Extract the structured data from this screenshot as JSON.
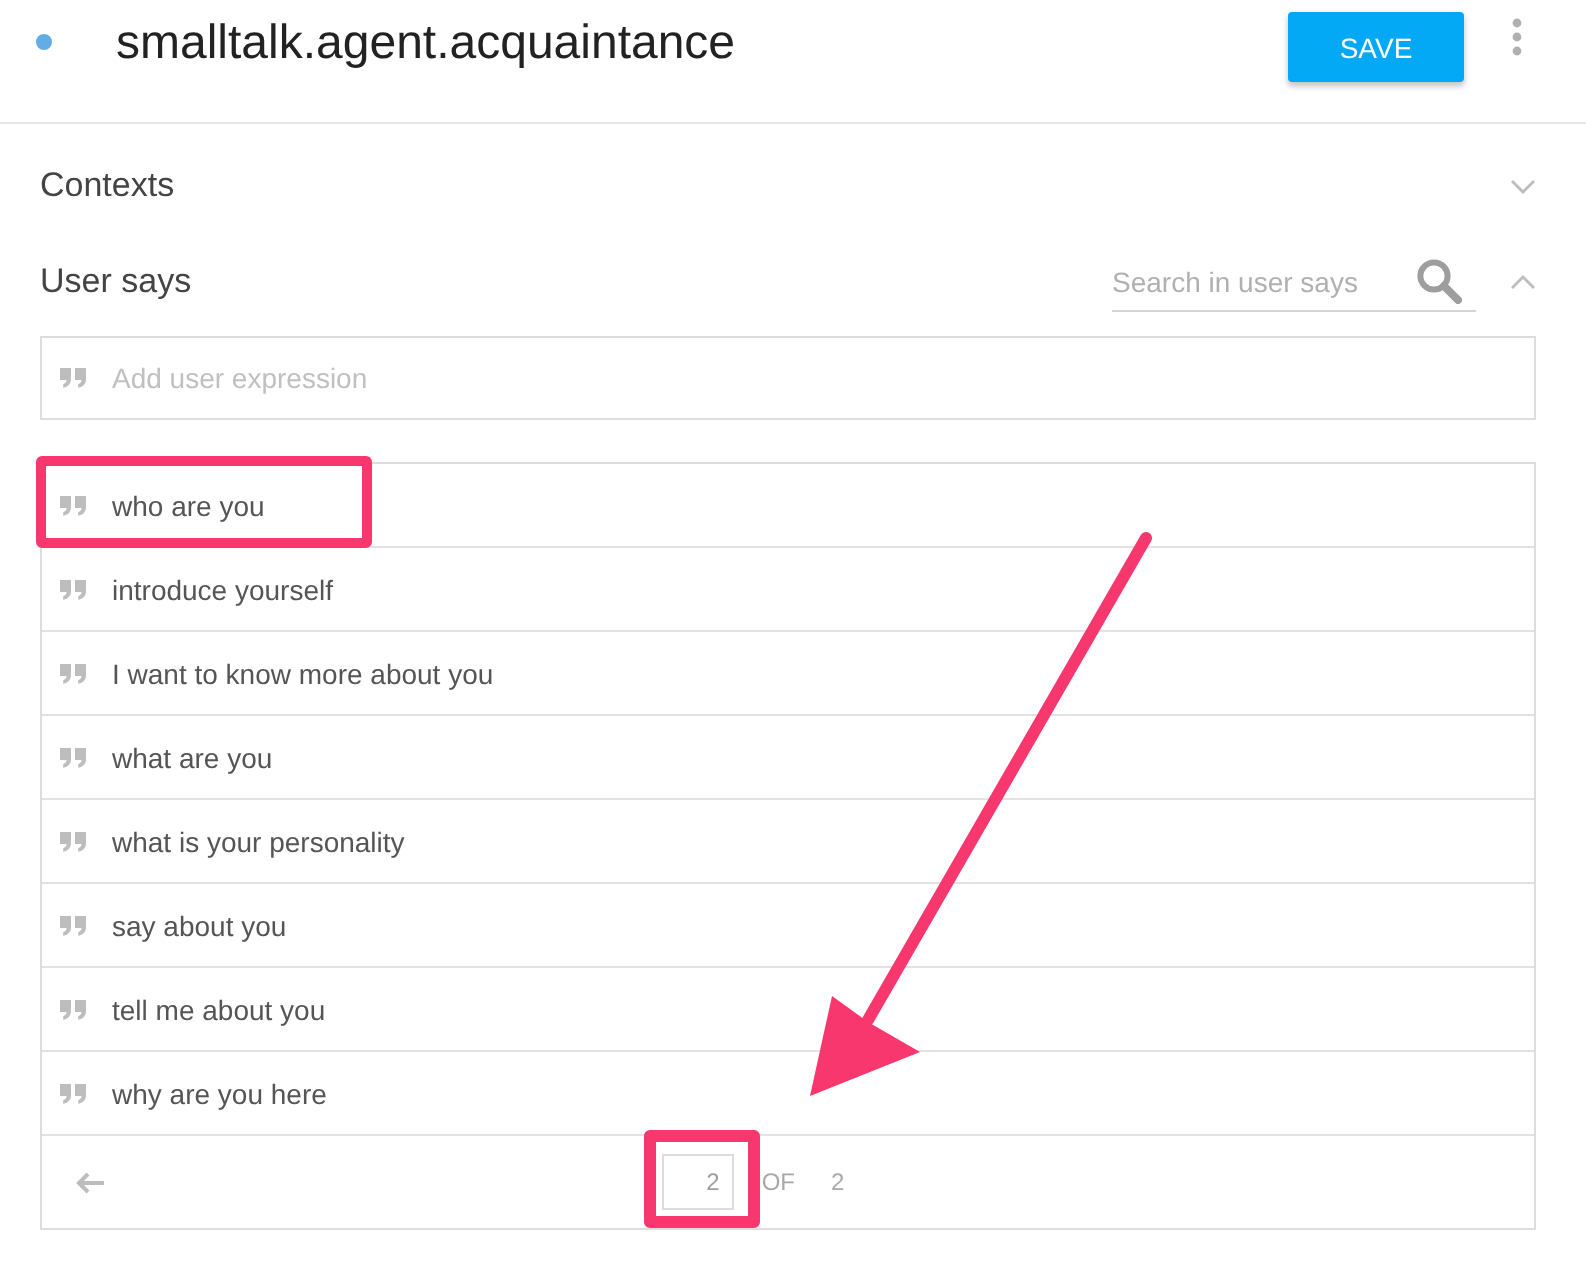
{
  "header": {
    "title": "smalltalk.agent.acquaintance",
    "save_label": "SAVE"
  },
  "contexts": {
    "label": "Contexts",
    "expanded": false
  },
  "user_says": {
    "label": "User says",
    "expanded": true,
    "search": {
      "placeholder": "Search in user says"
    },
    "add_field": {
      "placeholder": "Add user expression"
    },
    "expressions": [
      {
        "text": "who are you",
        "highlighted": true
      },
      {
        "text": "introduce yourself",
        "highlighted": false
      },
      {
        "text": "I want to know more about you",
        "highlighted": false
      },
      {
        "text": "what are you",
        "highlighted": false
      },
      {
        "text": "what is your personality",
        "highlighted": false
      },
      {
        "text": "say about you",
        "highlighted": false
      },
      {
        "text": "tell me about you",
        "highlighted": false
      },
      {
        "text": "why are you here",
        "highlighted": false
      }
    ],
    "pagination": {
      "page": "2",
      "of_label": "OF",
      "total": "2",
      "highlighted": true
    }
  }
}
